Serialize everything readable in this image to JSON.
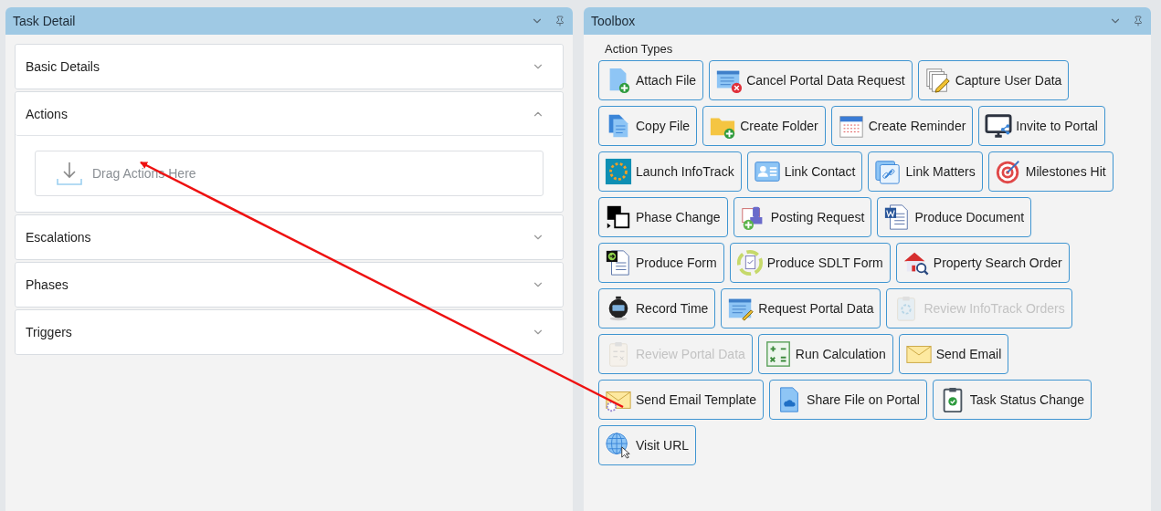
{
  "left_panel": {
    "title": "Task Detail",
    "sections": [
      {
        "title": "Basic Details",
        "expanded": false
      },
      {
        "title": "Actions",
        "expanded": true,
        "drop_zone": "Drag Actions Here"
      },
      {
        "title": "Escalations",
        "expanded": false
      },
      {
        "title": "Phases",
        "expanded": false
      },
      {
        "title": "Triggers",
        "expanded": false
      }
    ]
  },
  "right_panel": {
    "title": "Toolbox",
    "group_label": "Action Types",
    "rows": [
      {
        "buttons": [
          {
            "label": "Attach File",
            "disabled": false
          },
          {
            "label": "Cancel Portal Data Request",
            "disabled": false
          },
          {
            "label": "Capture User Data",
            "disabled": false
          }
        ]
      },
      {
        "buttons": [
          {
            "label": "Copy File",
            "disabled": false
          },
          {
            "label": "Create Folder",
            "disabled": false
          },
          {
            "label": "Create Reminder",
            "disabled": false
          },
          {
            "label": "Invite to Portal",
            "disabled": false
          }
        ]
      },
      {
        "buttons": [
          {
            "label": "Launch InfoTrack",
            "disabled": false
          },
          {
            "label": "Link Contact",
            "disabled": false
          },
          {
            "label": "Link Matters",
            "disabled": false
          },
          {
            "label": "Milestones Hit",
            "disabled": false
          }
        ]
      },
      {
        "buttons": [
          {
            "label": "Phase Change",
            "disabled": false
          },
          {
            "label": "Posting Request",
            "disabled": false
          },
          {
            "label": "Produce Document",
            "disabled": false
          }
        ]
      },
      {
        "buttons": [
          {
            "label": "Produce Form",
            "disabled": false
          },
          {
            "label": "Produce SDLT Form",
            "disabled": false
          },
          {
            "label": "Property Search Order",
            "disabled": false
          }
        ]
      },
      {
        "buttons": [
          {
            "label": "Record Time",
            "disabled": false
          },
          {
            "label": "Request Portal Data",
            "disabled": false
          },
          {
            "label": "Review InfoTrack Orders",
            "disabled": true
          }
        ]
      },
      {
        "buttons": [
          {
            "label": "Review Portal Data",
            "disabled": true
          },
          {
            "label": "Run Calculation",
            "disabled": false
          },
          {
            "label": "Send Email",
            "disabled": false
          }
        ]
      },
      {
        "buttons": [
          {
            "label": "Send Email Template",
            "disabled": false
          },
          {
            "label": "Share File on Portal",
            "disabled": false
          },
          {
            "label": "Task Status Change",
            "disabled": false
          }
        ]
      },
      {
        "buttons": [
          {
            "label": "Visit URL",
            "disabled": false
          }
        ]
      }
    ]
  }
}
